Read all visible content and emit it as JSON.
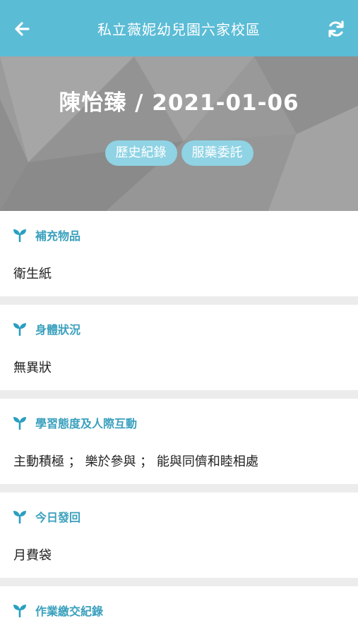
{
  "header": {
    "title": "私立薇妮幼兒園六家校區"
  },
  "hero": {
    "student_date": "陳怡臻 / 2021-01-06",
    "buttons": [
      "歷史紀錄",
      "服藥委託"
    ]
  },
  "sections": [
    {
      "title": "補充物品",
      "value": "衛生紙"
    },
    {
      "title": "身體狀況",
      "value": "無異狀"
    },
    {
      "title": "學習態度及人際互動",
      "value": "主動積極 ； 樂於參與 ； 能與同儕和睦相處"
    },
    {
      "title": "今日發回",
      "value": "月費袋"
    },
    {
      "title": "作業繳交紀錄",
      "value": ""
    }
  ],
  "colors": {
    "accent": "#5bbcd6",
    "pill": "#8fd3e4",
    "section_title": "#3aa0bd"
  },
  "icons": {
    "back": "arrow-left-icon",
    "refresh": "refresh-icon",
    "section": "sprout-icon"
  }
}
